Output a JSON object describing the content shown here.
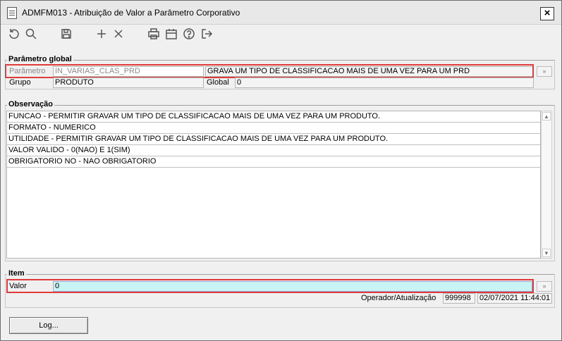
{
  "window": {
    "title": "ADMFM013 - Atribuição de Valor a Parâmetro Corporativo",
    "close_label": "×"
  },
  "toolbar": {
    "icons": [
      "refresh-icon",
      "search-icon",
      "save-icon",
      "add-icon",
      "delete-icon",
      "print-icon",
      "calendar-icon",
      "help-icon",
      "exit-icon"
    ]
  },
  "parametro_global": {
    "legend": "Parâmetro global",
    "parametro_label": "Parâmetro",
    "parametro_value": "IN_VARIAS_CLAS_PRD",
    "parametro_desc": "GRAVA UM TIPO DE CLASSIFICACAO MAIS DE UMA VEZ PARA UM PRD",
    "grupo_label": "Grupo",
    "grupo_value": "PRODUTO",
    "global_label": "Global",
    "global_value": "0",
    "lookup_label": "»"
  },
  "observacao": {
    "legend": "Observação",
    "rows": [
      "FUNCAO -  PERMITIR GRAVAR UM TIPO DE CLASSIFICACAO MAIS DE UMA VEZ PARA UM PRODUTO.",
      "FORMATO - NUMERICO",
      "UTILIDADE - PERMITIR GRAVAR UM TIPO DE CLASSIFICACAO MAIS DE UMA VEZ PARA UM PRODUTO.",
      "VALOR VALIDO - 0(NAO) E 1(SIM)",
      "OBRIGATORIO NO - NAO OBRIGATORIO"
    ]
  },
  "item": {
    "legend": "Item",
    "valor_label": "Valor",
    "valor_value": "0",
    "operador_label": "Operador/Atualização",
    "operador_value": "999998",
    "data_value": "02/07/2021 11:44:01",
    "lookup_label": "»"
  },
  "buttons": {
    "log_label": "Log..."
  },
  "colors": {
    "highlight": "#e03a3a",
    "valor_field": "#c8f4f4"
  }
}
